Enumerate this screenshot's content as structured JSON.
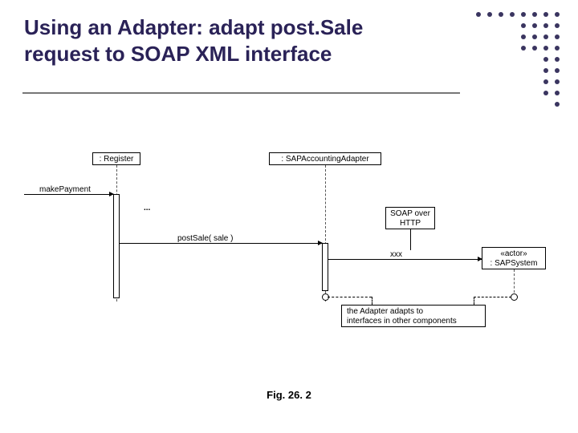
{
  "title": "Using an Adapter: adapt post.Sale request to SOAP XML interface",
  "participants": {
    "register": ": Register",
    "adapter": ": SAPAccountingAdapter",
    "actor": "«actor»\n: SAPSystem"
  },
  "messages": {
    "makePayment": "makePayment",
    "dots": "...",
    "postSale": "postSale( sale )",
    "xxx": "xxx"
  },
  "notes": {
    "soap": "SOAP over\nHTTP",
    "adapterNote": "the Adapter adapts to\ninterfaces in other components"
  },
  "caption": "Fig. 26. 2"
}
